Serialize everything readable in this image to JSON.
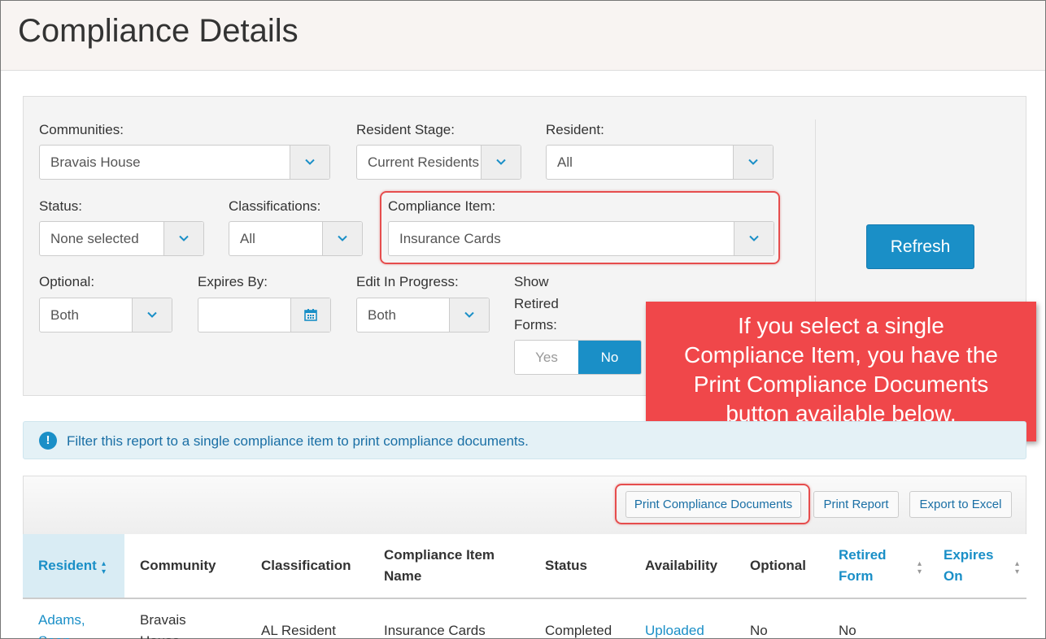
{
  "page": {
    "title": "Compliance Details"
  },
  "filters": {
    "communities": {
      "label": "Communities:",
      "value": "Bravais House"
    },
    "resident_stage": {
      "label": "Resident Stage:",
      "value": "Current Residents"
    },
    "resident": {
      "label": "Resident:",
      "value": "All"
    },
    "status": {
      "label": "Status:",
      "value": "None selected"
    },
    "classifications": {
      "label": "Classifications:",
      "value": "All"
    },
    "compliance_item": {
      "label": "Compliance Item:",
      "value": "Insurance Cards"
    },
    "optional": {
      "label": "Optional:",
      "value": "Both"
    },
    "expires_by": {
      "label": "Expires By:",
      "value": ""
    },
    "edit_in_progress": {
      "label": "Edit In Progress:",
      "value": "Both"
    },
    "show_retired": {
      "label_line1": "Show",
      "label_line2": "Retired",
      "label_line3": "Forms:",
      "yes": "Yes",
      "no": "No",
      "selected": "No"
    },
    "refresh_label": "Refresh"
  },
  "callout": {
    "line1": "If you select a single",
    "line2": "Compliance Item, you have the",
    "line3": "Print Compliance Documents",
    "line4": "button available below."
  },
  "info": {
    "icon": "!",
    "text": "Filter this report to a single compliance item to print compliance documents."
  },
  "toolbar": {
    "print_docs": "Print Compliance Documents",
    "print_report": "Print Report",
    "export": "Export to Excel"
  },
  "table": {
    "headers": {
      "resident": "Resident",
      "community": "Community",
      "classification": "Classification",
      "item_name_1": "Compliance Item",
      "item_name_2": "Name",
      "status": "Status",
      "availability": "Availability",
      "optional": "Optional",
      "retired_1": "Retired",
      "retired_2": "Form",
      "expires_1": "Expires",
      "expires_2": "On"
    },
    "rows": [
      {
        "resident_1": "Adams,",
        "resident_2": "Sean",
        "community_1": "Bravais",
        "community_2": "House",
        "classification": "AL Resident",
        "item": "Insurance Cards",
        "status": "Completed",
        "availability": "Uploaded",
        "optional": "No",
        "retired": "No"
      }
    ]
  },
  "colors": {
    "accent": "#1a8fc7",
    "callout": "#f0474a",
    "highlight": "#e64d4d"
  }
}
